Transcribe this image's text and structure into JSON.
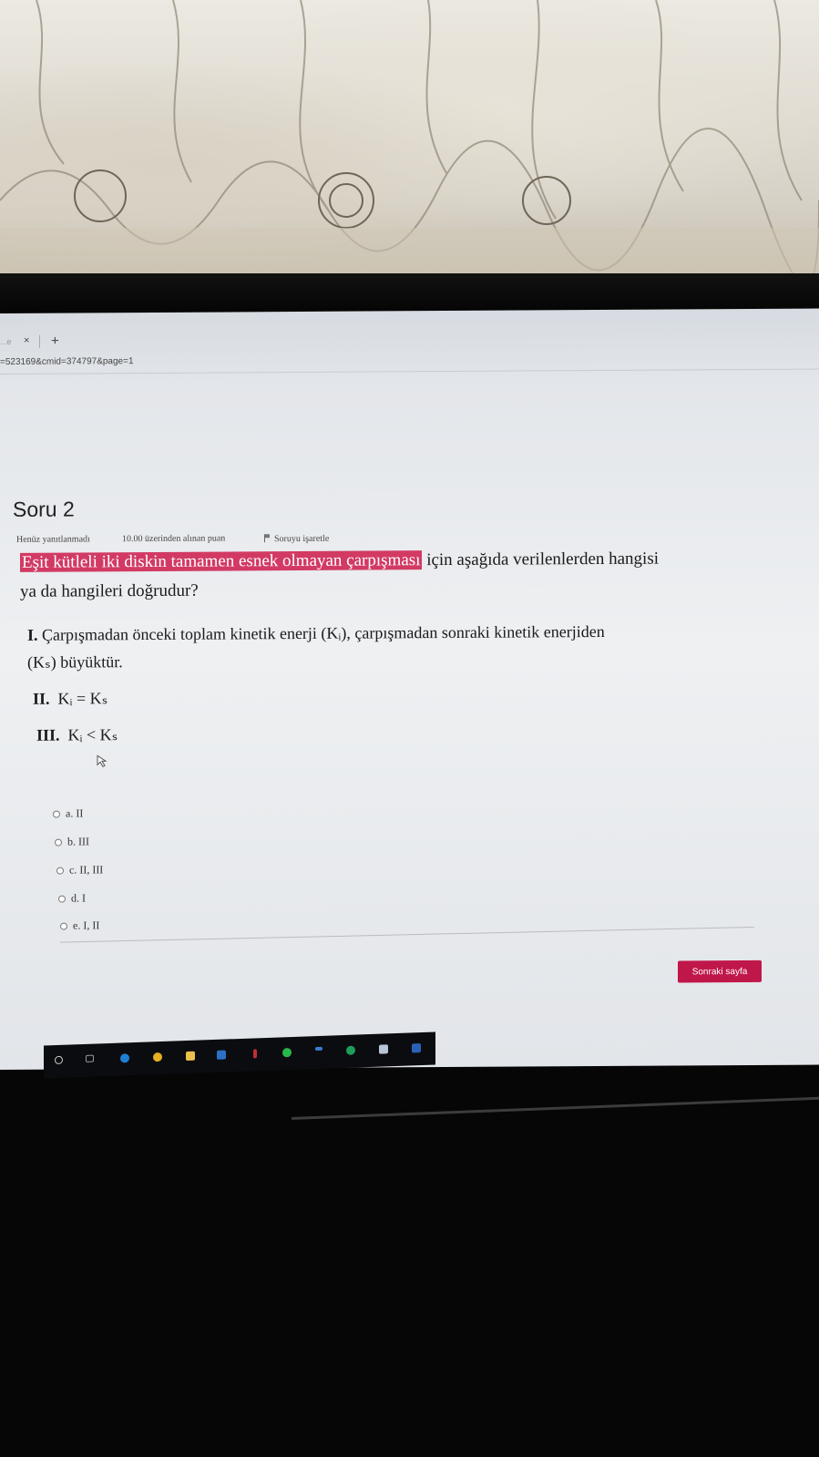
{
  "browser": {
    "tab_fragment": "...e",
    "tab_close": "×",
    "new_tab": "+",
    "url": "=523169&cmid=374797&page=1"
  },
  "question": {
    "title": "Soru 2",
    "status": "Henüz yanıtlanmadı",
    "points": "10.00 üzerinden alınan puan",
    "flag_label": "Soruyu işaretle",
    "stem_highlight": "Eşit kütleli iki diskin tamamen esnek olmayan çarpışması",
    "stem_rest_line1": " için aşağıda verilenlerden hangisi",
    "stem_line2": "ya da hangileri doğrudur?",
    "statements": [
      {
        "num": "I.",
        "text": "Çarpışmadan önceki toplam kinetik enerji (Kᵢ), çarpışmadan sonraki kinetik enerjiden",
        "cont": "(Kₛ) büyüktür."
      },
      {
        "num": "II.",
        "text": "Kᵢ = Kₛ"
      },
      {
        "num": "III.",
        "text": "Kᵢ < Kₛ"
      }
    ],
    "options": [
      "a. II",
      "b. III",
      "c. II, III",
      "d. I",
      "e. I, II"
    ]
  },
  "nav": {
    "next_label": "Sonraki sayfa"
  },
  "colors": {
    "highlight": "#d23a64",
    "button": "#c0174b"
  },
  "taskbar_icons": [
    "search-icon",
    "task-view-icon",
    "edge-icon",
    "chrome-icon",
    "folder-icon",
    "mail-icon",
    "whatsapp-icon",
    "check-icon",
    "green-app-icon",
    "shield-icon",
    "blue-app-icon"
  ]
}
